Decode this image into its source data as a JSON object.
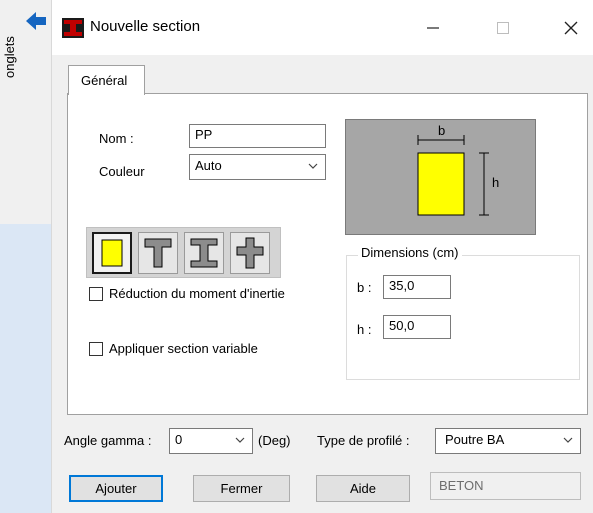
{
  "side_panel": {
    "label": "onglets"
  },
  "window": {
    "title": "Nouvelle section"
  },
  "tabs": [
    {
      "label": "Général"
    }
  ],
  "form": {
    "nom_label": "Nom :",
    "nom_value": "PP",
    "couleur_label": "Couleur",
    "couleur_value": "Auto"
  },
  "preview": {
    "dim_b": "b",
    "dim_h": "h"
  },
  "section_shapes": [
    {
      "name": "rectangle",
      "selected": true
    },
    {
      "name": "t-section",
      "selected": false
    },
    {
      "name": "i-section",
      "selected": false
    },
    {
      "name": "cross-section",
      "selected": false
    }
  ],
  "options": {
    "reduction_label": "Réduction du moment d'inertie",
    "reduction_checked": false,
    "variable_label": "Appliquer section variable",
    "variable_checked": false
  },
  "dimensions": {
    "title": "Dimensions (cm)",
    "b_label": "b :",
    "b_value": "35,0",
    "h_label": "h :",
    "h_value": "50,0"
  },
  "bottom": {
    "angle_label": "Angle gamma :",
    "angle_value": "0",
    "angle_unit": "(Deg)",
    "type_label": "Type de profilé :",
    "type_value": "Poutre BA",
    "material": "BETON"
  },
  "buttons": {
    "add": "Ajouter",
    "close": "Fermer",
    "help": "Aide"
  },
  "colors": {
    "section_fill": "#ffff00",
    "preview_bg": "#a6a6a6",
    "arrow_blue": "#1565c0",
    "icon_red": "#c00000"
  }
}
